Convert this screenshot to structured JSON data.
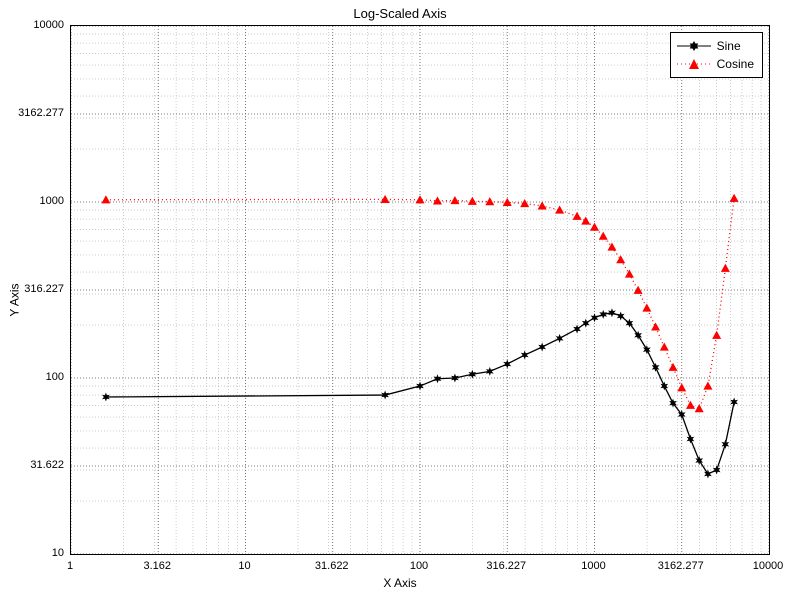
{
  "chart_data": {
    "type": "line",
    "title": "Log-Scaled Axis",
    "xlabel": "X Axis",
    "ylabel": "Y Axis",
    "xscale": "log",
    "yscale": "log",
    "xlim": [
      1,
      10000
    ],
    "ylim": [
      10,
      10000
    ],
    "x_tick_labels": [
      "1",
      "3.162",
      "10",
      "31.622",
      "100",
      "316.227",
      "1000",
      "3162.277",
      "10000"
    ],
    "x_tick_values": [
      1,
      3.162,
      10,
      31.622,
      100,
      316.227,
      1000,
      3162.277,
      10000
    ],
    "y_tick_labels": [
      "10",
      "31.622",
      "100",
      "316.227",
      "1000",
      "3162.277",
      "10000"
    ],
    "y_tick_values": [
      10,
      31.622,
      100,
      316.227,
      1000,
      3162.277,
      10000
    ],
    "grid": {
      "major": true,
      "minor": true,
      "style": "dotted"
    },
    "legend": {
      "position": "upper-right",
      "entries": [
        "Sine",
        "Cosine"
      ]
    },
    "series": [
      {
        "name": "Sine",
        "marker": "star6",
        "color": "#000000",
        "linestyle": "solid",
        "x": [
          1.585,
          63.1,
          100,
          125.9,
          158.5,
          199.5,
          251.2,
          316.2,
          398.1,
          501.2,
          631,
          794.3,
          891.3,
          1000,
          1122,
          1259,
          1413,
          1585,
          1778,
          1995,
          2239,
          2512,
          2818,
          3162,
          3548,
          3981,
          4467,
          5012,
          5623,
          6310
        ],
        "y": [
          78.0,
          80.0,
          90.0,
          99.0,
          100.0,
          105.0,
          109.0,
          120.0,
          135.0,
          150.0,
          168.0,
          190.0,
          205.0,
          220.0,
          230.0,
          235.0,
          225.0,
          205.0,
          175.0,
          145.0,
          115.0,
          90.0,
          72.0,
          62.0,
          45.0,
          34.0,
          28.5,
          30.0,
          42.0,
          73.0
        ]
      },
      {
        "name": "Cosine",
        "marker": "triangle",
        "color": "#ff0000",
        "linestyle": "dotted",
        "x": [
          1.585,
          63.1,
          100,
          125.9,
          158.5,
          199.5,
          251.2,
          316.2,
          398.1,
          501.2,
          631,
          794.3,
          891.3,
          1000,
          1122,
          1259,
          1413,
          1585,
          1778,
          1995,
          2239,
          2512,
          2818,
          3162,
          3548,
          3981,
          4467,
          5012,
          5623,
          6310
        ],
        "y": [
          1030,
          1035,
          1030,
          1015,
          1020,
          1010,
          1005,
          995,
          980,
          950,
          900,
          830,
          780,
          720,
          640,
          555,
          470,
          390,
          315,
          250,
          195,
          150,
          115,
          88,
          70,
          67,
          90,
          175,
          420,
          1050
        ]
      }
    ]
  }
}
